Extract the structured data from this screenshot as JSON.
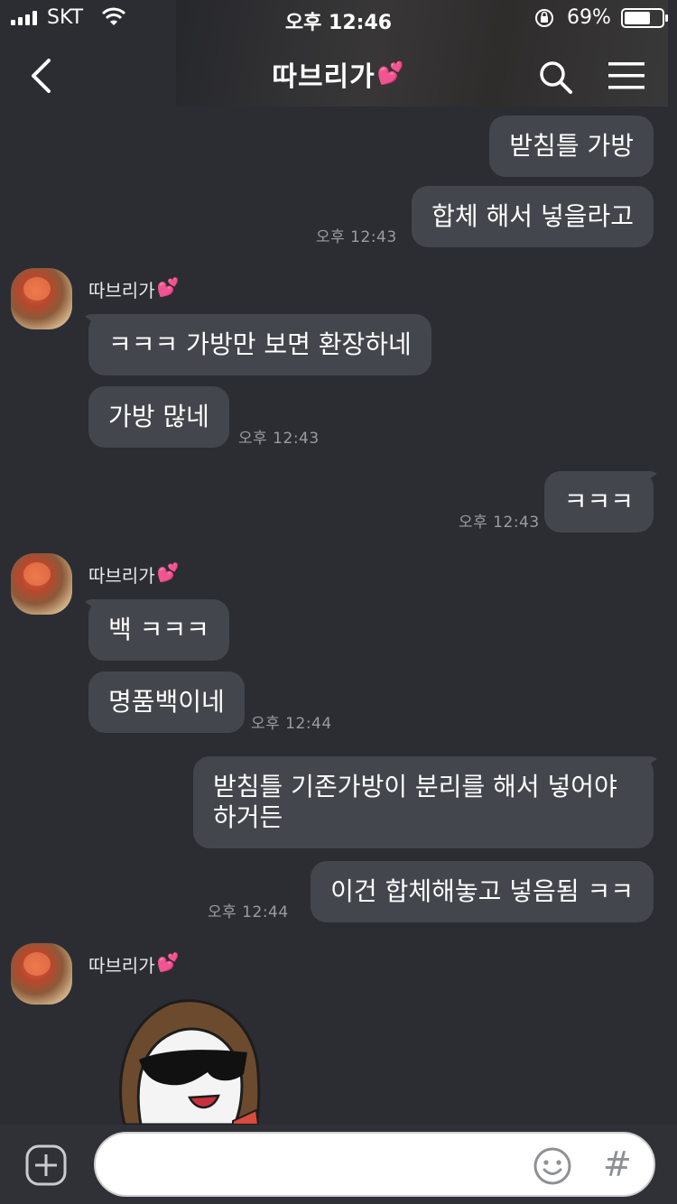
{
  "status_bar": {
    "carrier": "SKT",
    "time": "오후 12:46",
    "battery_percent": "69%",
    "battery_level": 0.69
  },
  "header": {
    "title": "따브리가",
    "title_emoji": "💕",
    "icons": [
      "back-icon",
      "search-icon",
      "menu-icon"
    ]
  },
  "messages": {
    "m1": "받침틀 가방",
    "m2": "합체 해서 넣을라고",
    "t2": "오후 12:43",
    "sender1": "따브리가",
    "m3": "ㅋㅋㅋ 가방만 보면 환장하네",
    "m4": "가방 많네",
    "t4": "오후 12:43",
    "m5": "ㅋㅋㅋ",
    "t5": "오후 12:43",
    "sender2": "따브리가",
    "m6": "백 ㅋㅋㅋ",
    "m7": "명품백이네",
    "t7": "오후 12:44",
    "m8": "받침틀 기존가방이 분리를 해서 넣어야 하거든",
    "m9": "이건 합체해놓고 넣음됨 ㅋㅋ",
    "t9": "오후 12:44",
    "sender3": "따브리가",
    "heart": "💕"
  },
  "composer": {
    "placeholder": "",
    "icons": [
      "plus-icon",
      "emoji-icon",
      "hash-icon"
    ],
    "hash_glyph": "#"
  },
  "colors": {
    "background": "#2b2d33",
    "bubble": "#44464d",
    "timestamp": "#9a9ca3",
    "heart": "#ff4fb6"
  }
}
